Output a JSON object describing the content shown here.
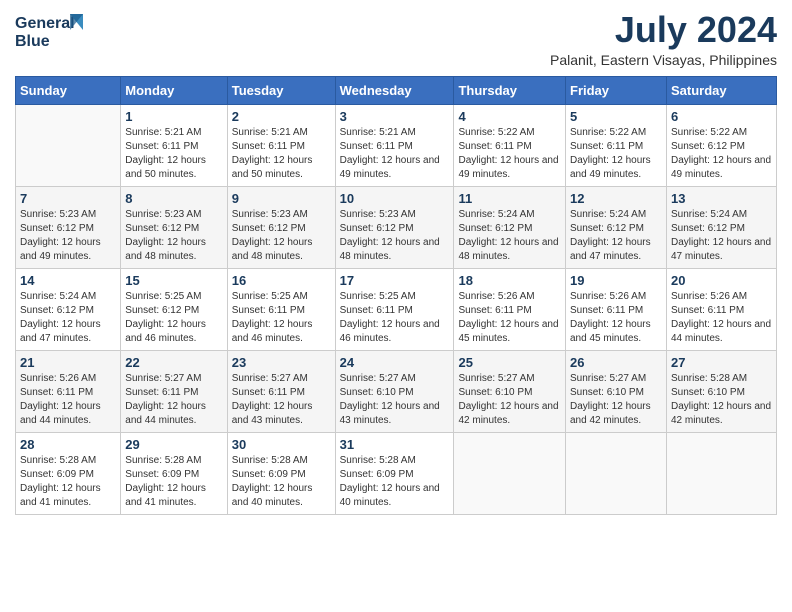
{
  "header": {
    "logo_line1": "General",
    "logo_line2": "Blue",
    "title": "July 2024",
    "subtitle": "Palanit, Eastern Visayas, Philippines"
  },
  "weekdays": [
    "Sunday",
    "Monday",
    "Tuesday",
    "Wednesday",
    "Thursday",
    "Friday",
    "Saturday"
  ],
  "weeks": [
    [
      {
        "day": "",
        "sunrise": "",
        "sunset": "",
        "daylight": ""
      },
      {
        "day": "1",
        "sunrise": "Sunrise: 5:21 AM",
        "sunset": "Sunset: 6:11 PM",
        "daylight": "Daylight: 12 hours and 50 minutes."
      },
      {
        "day": "2",
        "sunrise": "Sunrise: 5:21 AM",
        "sunset": "Sunset: 6:11 PM",
        "daylight": "Daylight: 12 hours and 50 minutes."
      },
      {
        "day": "3",
        "sunrise": "Sunrise: 5:21 AM",
        "sunset": "Sunset: 6:11 PM",
        "daylight": "Daylight: 12 hours and 49 minutes."
      },
      {
        "day": "4",
        "sunrise": "Sunrise: 5:22 AM",
        "sunset": "Sunset: 6:11 PM",
        "daylight": "Daylight: 12 hours and 49 minutes."
      },
      {
        "day": "5",
        "sunrise": "Sunrise: 5:22 AM",
        "sunset": "Sunset: 6:11 PM",
        "daylight": "Daylight: 12 hours and 49 minutes."
      },
      {
        "day": "6",
        "sunrise": "Sunrise: 5:22 AM",
        "sunset": "Sunset: 6:12 PM",
        "daylight": "Daylight: 12 hours and 49 minutes."
      }
    ],
    [
      {
        "day": "7",
        "sunrise": "Sunrise: 5:23 AM",
        "sunset": "Sunset: 6:12 PM",
        "daylight": "Daylight: 12 hours and 49 minutes."
      },
      {
        "day": "8",
        "sunrise": "Sunrise: 5:23 AM",
        "sunset": "Sunset: 6:12 PM",
        "daylight": "Daylight: 12 hours and 48 minutes."
      },
      {
        "day": "9",
        "sunrise": "Sunrise: 5:23 AM",
        "sunset": "Sunset: 6:12 PM",
        "daylight": "Daylight: 12 hours and 48 minutes."
      },
      {
        "day": "10",
        "sunrise": "Sunrise: 5:23 AM",
        "sunset": "Sunset: 6:12 PM",
        "daylight": "Daylight: 12 hours and 48 minutes."
      },
      {
        "day": "11",
        "sunrise": "Sunrise: 5:24 AM",
        "sunset": "Sunset: 6:12 PM",
        "daylight": "Daylight: 12 hours and 48 minutes."
      },
      {
        "day": "12",
        "sunrise": "Sunrise: 5:24 AM",
        "sunset": "Sunset: 6:12 PM",
        "daylight": "Daylight: 12 hours and 47 minutes."
      },
      {
        "day": "13",
        "sunrise": "Sunrise: 5:24 AM",
        "sunset": "Sunset: 6:12 PM",
        "daylight": "Daylight: 12 hours and 47 minutes."
      }
    ],
    [
      {
        "day": "14",
        "sunrise": "Sunrise: 5:24 AM",
        "sunset": "Sunset: 6:12 PM",
        "daylight": "Daylight: 12 hours and 47 minutes."
      },
      {
        "day": "15",
        "sunrise": "Sunrise: 5:25 AM",
        "sunset": "Sunset: 6:12 PM",
        "daylight": "Daylight: 12 hours and 46 minutes."
      },
      {
        "day": "16",
        "sunrise": "Sunrise: 5:25 AM",
        "sunset": "Sunset: 6:11 PM",
        "daylight": "Daylight: 12 hours and 46 minutes."
      },
      {
        "day": "17",
        "sunrise": "Sunrise: 5:25 AM",
        "sunset": "Sunset: 6:11 PM",
        "daylight": "Daylight: 12 hours and 46 minutes."
      },
      {
        "day": "18",
        "sunrise": "Sunrise: 5:26 AM",
        "sunset": "Sunset: 6:11 PM",
        "daylight": "Daylight: 12 hours and 45 minutes."
      },
      {
        "day": "19",
        "sunrise": "Sunrise: 5:26 AM",
        "sunset": "Sunset: 6:11 PM",
        "daylight": "Daylight: 12 hours and 45 minutes."
      },
      {
        "day": "20",
        "sunrise": "Sunrise: 5:26 AM",
        "sunset": "Sunset: 6:11 PM",
        "daylight": "Daylight: 12 hours and 44 minutes."
      }
    ],
    [
      {
        "day": "21",
        "sunrise": "Sunrise: 5:26 AM",
        "sunset": "Sunset: 6:11 PM",
        "daylight": "Daylight: 12 hours and 44 minutes."
      },
      {
        "day": "22",
        "sunrise": "Sunrise: 5:27 AM",
        "sunset": "Sunset: 6:11 PM",
        "daylight": "Daylight: 12 hours and 44 minutes."
      },
      {
        "day": "23",
        "sunrise": "Sunrise: 5:27 AM",
        "sunset": "Sunset: 6:11 PM",
        "daylight": "Daylight: 12 hours and 43 minutes."
      },
      {
        "day": "24",
        "sunrise": "Sunrise: 5:27 AM",
        "sunset": "Sunset: 6:10 PM",
        "daylight": "Daylight: 12 hours and 43 minutes."
      },
      {
        "day": "25",
        "sunrise": "Sunrise: 5:27 AM",
        "sunset": "Sunset: 6:10 PM",
        "daylight": "Daylight: 12 hours and 42 minutes."
      },
      {
        "day": "26",
        "sunrise": "Sunrise: 5:27 AM",
        "sunset": "Sunset: 6:10 PM",
        "daylight": "Daylight: 12 hours and 42 minutes."
      },
      {
        "day": "27",
        "sunrise": "Sunrise: 5:28 AM",
        "sunset": "Sunset: 6:10 PM",
        "daylight": "Daylight: 12 hours and 42 minutes."
      }
    ],
    [
      {
        "day": "28",
        "sunrise": "Sunrise: 5:28 AM",
        "sunset": "Sunset: 6:09 PM",
        "daylight": "Daylight: 12 hours and 41 minutes."
      },
      {
        "day": "29",
        "sunrise": "Sunrise: 5:28 AM",
        "sunset": "Sunset: 6:09 PM",
        "daylight": "Daylight: 12 hours and 41 minutes."
      },
      {
        "day": "30",
        "sunrise": "Sunrise: 5:28 AM",
        "sunset": "Sunset: 6:09 PM",
        "daylight": "Daylight: 12 hours and 40 minutes."
      },
      {
        "day": "31",
        "sunrise": "Sunrise: 5:28 AM",
        "sunset": "Sunset: 6:09 PM",
        "daylight": "Daylight: 12 hours and 40 minutes."
      },
      {
        "day": "",
        "sunrise": "",
        "sunset": "",
        "daylight": ""
      },
      {
        "day": "",
        "sunrise": "",
        "sunset": "",
        "daylight": ""
      },
      {
        "day": "",
        "sunrise": "",
        "sunset": "",
        "daylight": ""
      }
    ]
  ]
}
